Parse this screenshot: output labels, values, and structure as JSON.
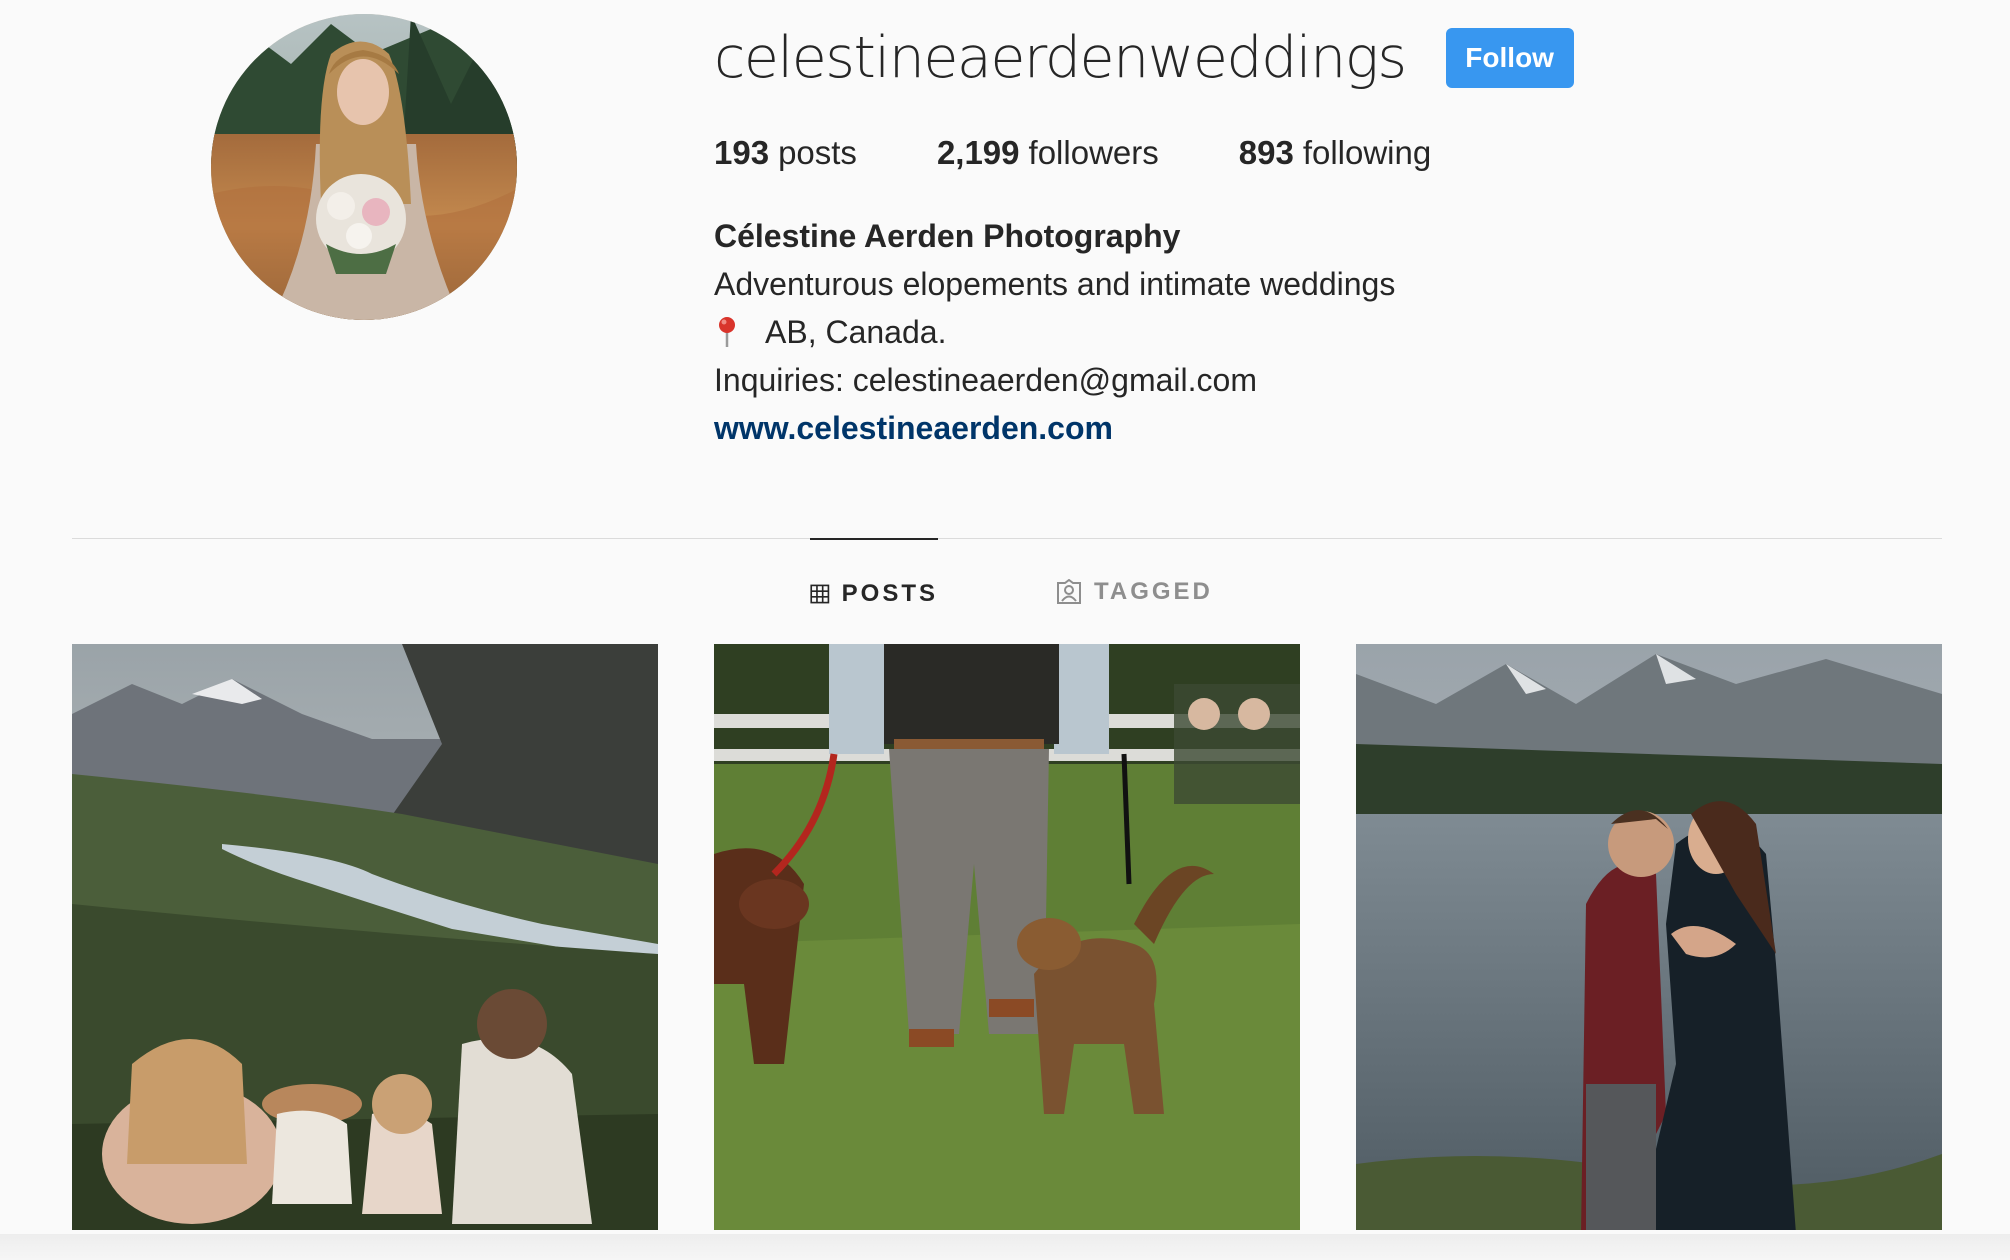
{
  "profile": {
    "username": "celestineaerdenweddings",
    "follow_label": "Follow",
    "stats": {
      "posts_count": "193",
      "posts_label": "posts",
      "followers_count": "2,199",
      "followers_label": "followers",
      "following_count": "893",
      "following_label": "following"
    },
    "bio": {
      "full_name": "Célestine Aerden Photography",
      "tagline": "Adventurous elopements and intimate weddings",
      "location": "AB, Canada.",
      "inquiries": "Inquiries: celestineaerden@gmail.com",
      "website": "www.celestineaerden.com"
    }
  },
  "tabs": {
    "posts_label": "POSTS",
    "tagged_label": "TAGGED"
  },
  "icons": {
    "pin": "round-pushpin-icon",
    "posts": "grid-icon",
    "tagged": "tagged-person-icon"
  },
  "colors": {
    "follow_button": "#3897f0",
    "link": "#003569",
    "text": "#262626",
    "muted": "#8e8e8e",
    "background": "#fafafa"
  }
}
